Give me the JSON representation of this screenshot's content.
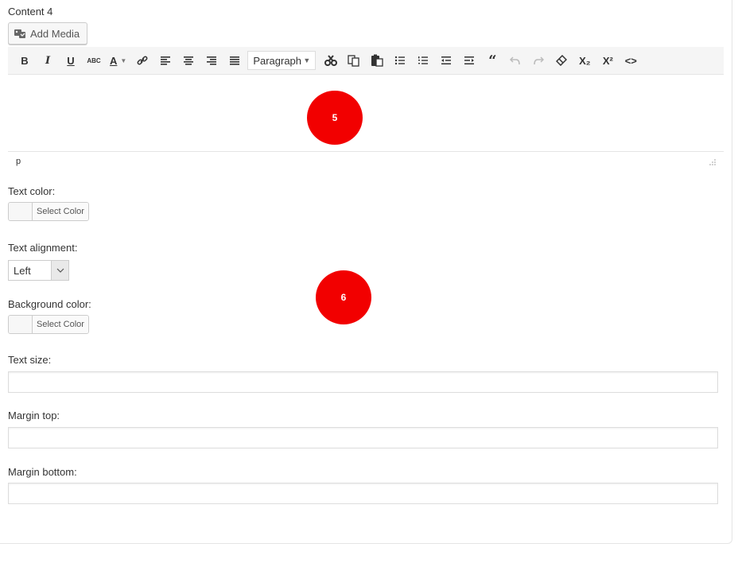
{
  "content_label": "Content 4",
  "add_media_label": "Add Media",
  "toolbar": {
    "bold": "B",
    "italic": "I",
    "underline": "U",
    "strike": "ABC",
    "text_color": "A",
    "format_select": "Paragraph",
    "subscript": "X₂",
    "superscript": "X²",
    "code": "<>"
  },
  "status_path": "p",
  "markers": {
    "five": "5",
    "six": "6"
  },
  "fields": {
    "text_color_label": "Text color:",
    "text_alignment_label": "Text alignment:",
    "text_alignment_value": "Left",
    "background_color_label": "Background color:",
    "text_size_label": "Text size:",
    "margin_top_label": "Margin top:",
    "margin_bottom_label": "Margin bottom:",
    "select_color_label": "Select Color"
  },
  "colors": {
    "marker": "#f20000"
  }
}
